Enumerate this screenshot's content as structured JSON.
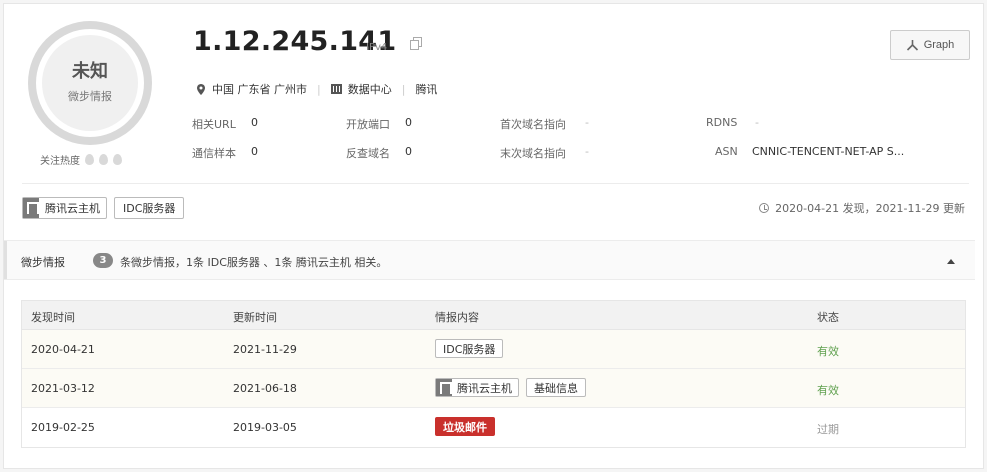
{
  "verdict": {
    "label": "未知",
    "sublabel": "微步情报"
  },
  "heat": {
    "label": "关注热度"
  },
  "ip": {
    "address": "1.12.245.141",
    "version": "IPv4"
  },
  "graph_button": {
    "label": "Graph"
  },
  "location": {
    "region": "中国 广东省 广州市",
    "type": "数据中心",
    "isp": "腾讯"
  },
  "stats": {
    "related_url": {
      "label": "相关URL",
      "value": "0"
    },
    "open_ports": {
      "label": "开放端口",
      "value": "0"
    },
    "first_domain": {
      "label": "首次域名指向",
      "value": "-"
    },
    "rdns": {
      "label": "RDNS",
      "value": "-"
    },
    "comm_samples": {
      "label": "通信样本",
      "value": "0"
    },
    "reverse_domains": {
      "label": "反查域名",
      "value": "0"
    },
    "last_domain": {
      "label": "末次域名指向",
      "value": "-"
    },
    "asn": {
      "label": "ASN",
      "value": "CNNIC-TENCENT-NET-AP S..."
    }
  },
  "tags": {
    "cloud": "腾讯云主机",
    "idc": "IDC服务器"
  },
  "timeline": {
    "text": "2020-04-21 发现，2021-11-29 更新"
  },
  "intel": {
    "title": "微步情报",
    "count": "3",
    "summary": "条微步情报，1条 IDC服务器 、1条 腾讯云主机 相关。"
  },
  "table": {
    "headers": [
      "发现时间",
      "更新时间",
      "情报内容",
      "状态"
    ],
    "rows": [
      {
        "found": "2020-04-21",
        "updated": "2021-11-29",
        "tags": [
          "IDC服务器"
        ],
        "status": "有效"
      },
      {
        "found": "2021-03-12",
        "updated": "2021-06-18",
        "tags": [
          "腾讯云主机",
          "基础信息"
        ],
        "status": "有效"
      },
      {
        "found": "2019-02-25",
        "updated": "2019-03-05",
        "tags": [
          "垃圾邮件"
        ],
        "status": "过期"
      }
    ]
  },
  "colors": {
    "valid": "#5fa04e",
    "expired": "#999999",
    "spam": "#c9302c"
  }
}
